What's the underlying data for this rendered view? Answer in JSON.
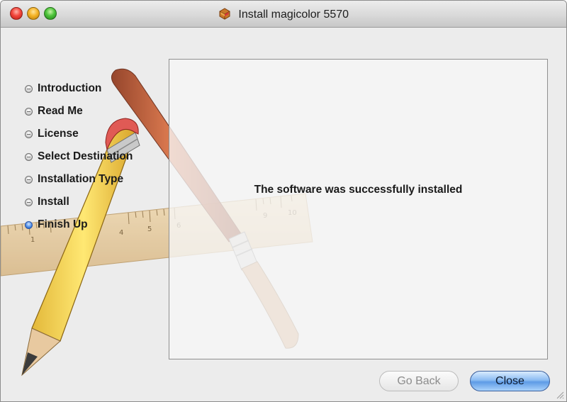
{
  "window": {
    "title": "Install magicolor 5570",
    "title_icon": "package-icon"
  },
  "steps": [
    {
      "label": "Introduction",
      "active": false
    },
    {
      "label": "Read Me",
      "active": false
    },
    {
      "label": "License",
      "active": false
    },
    {
      "label": "Select Destination",
      "active": false
    },
    {
      "label": "Installation Type",
      "active": false
    },
    {
      "label": "Install",
      "active": false
    },
    {
      "label": "Finish Up",
      "active": true
    }
  ],
  "content": {
    "message": "The software was successfully installed"
  },
  "buttons": {
    "go_back": "Go Back",
    "close": "Close"
  },
  "ruler": {
    "tick_labels": [
      "1",
      "4",
      "5",
      "6",
      "9",
      "10"
    ]
  },
  "colors": {
    "active_step": "#3b7ad8",
    "close_button": "#6aa6ec"
  }
}
